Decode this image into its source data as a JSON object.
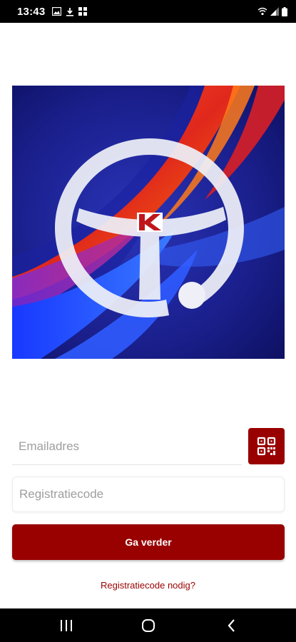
{
  "status_bar": {
    "time": "13:43",
    "left_icons": [
      "gallery-icon",
      "download-icon",
      "apps-grid-icon"
    ],
    "right_icons": [
      "wifi-icon",
      "signal-icon",
      "battery-icon"
    ]
  },
  "hero": {
    "icon": "steering-wheel-logo-icon"
  },
  "form": {
    "email_placeholder": "Emailadres",
    "registration_placeholder": "Registratiecode",
    "qr_icon": "qr-code-icon",
    "continue_label": "Ga verder",
    "need_code_label": "Registratiecode nodig?"
  },
  "nav_bar": {
    "icons": [
      "recent-apps-icon",
      "home-icon",
      "back-icon"
    ]
  },
  "colors": {
    "brand_red": "#990000",
    "hero_bg": "#16197a",
    "placeholder": "#9e9e9e"
  }
}
